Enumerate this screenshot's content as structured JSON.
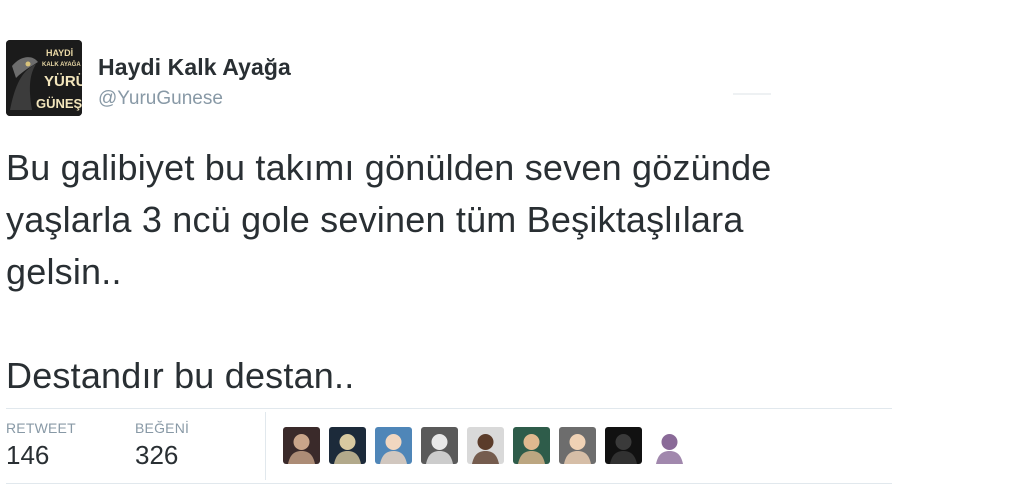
{
  "tweet": {
    "author": {
      "fullname": "Haydi Kalk Ayağa",
      "handle": "@YuruGunese",
      "avatar_text": [
        "HAYDİ",
        "KALK AYAĞA",
        "YÜRÜ",
        "GÜNEŞE!"
      ]
    },
    "text_lines": [
      "Bu galibiyet bu takımı gönülden seven gözünde",
      "yaşlarla 3 ncü gole sevinen tüm Beşiktaşlılara",
      "gelsin..",
      "Destandır bu destan.."
    ],
    "stats": {
      "retweet_label": "RETWEET",
      "retweet_count": "146",
      "likes_label": "BEĞENİ",
      "likes_count": "326"
    },
    "likers": [
      {
        "name": "liker-avatar-1",
        "bg": "#3a2a2a",
        "fg": "#c9a58a"
      },
      {
        "name": "liker-avatar-2",
        "bg": "#1c2a3a",
        "fg": "#d8c9a0"
      },
      {
        "name": "liker-avatar-3",
        "bg": "#4f86b8",
        "fg": "#f1d7c0"
      },
      {
        "name": "liker-avatar-4",
        "bg": "#5a5a5a",
        "fg": "#e8e8e8"
      },
      {
        "name": "liker-avatar-5",
        "bg": "#d9d9d9",
        "fg": "#5b3c2a"
      },
      {
        "name": "liker-avatar-6",
        "bg": "#2e5c4a",
        "fg": "#e0b98f"
      },
      {
        "name": "liker-avatar-7",
        "bg": "#6d6d6d",
        "fg": "#f0d2b5"
      },
      {
        "name": "liker-avatar-8",
        "bg": "#111111",
        "fg": "#3a3a3a"
      },
      {
        "name": "liker-avatar-9",
        "bg": "#ffffff",
        "fg": "#8a6a98"
      }
    ]
  }
}
